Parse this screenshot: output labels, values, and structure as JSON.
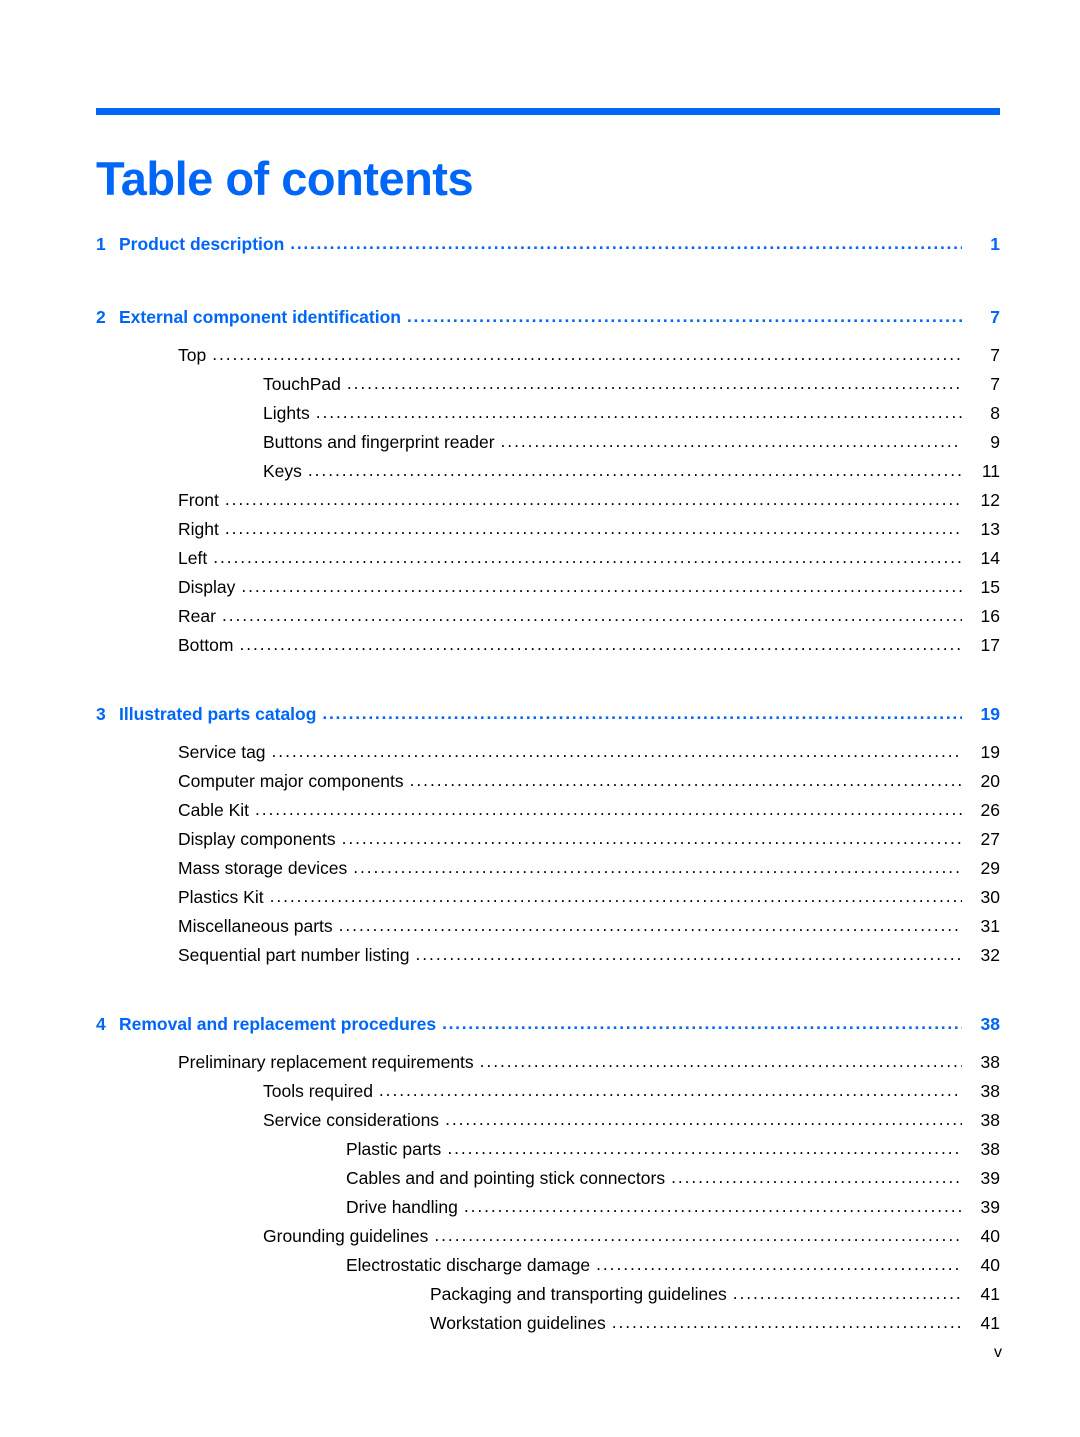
{
  "document": {
    "title": "Table of contents",
    "accent_color": "#0066f5",
    "footer_page_number": "v"
  },
  "toc": {
    "entries": [
      {
        "level": 0,
        "number": "1",
        "label": "Product description",
        "page": "1",
        "gap_before": false
      },
      {
        "level": 0,
        "number": "2",
        "label": "External component identification",
        "page": "7",
        "gap_before": true
      },
      {
        "level": 1,
        "number": "",
        "label": "Top",
        "page": "7",
        "gap_before": false
      },
      {
        "level": 2,
        "number": "",
        "label": "TouchPad",
        "page": "7",
        "gap_before": false
      },
      {
        "level": 2,
        "number": "",
        "label": "Lights",
        "page": "8",
        "gap_before": false
      },
      {
        "level": 2,
        "number": "",
        "label": "Buttons and fingerprint reader",
        "page": "9",
        "gap_before": false
      },
      {
        "level": 2,
        "number": "",
        "label": "Keys",
        "page": "11",
        "gap_before": false
      },
      {
        "level": 1,
        "number": "",
        "label": "Front",
        "page": "12",
        "gap_before": false
      },
      {
        "level": 1,
        "number": "",
        "label": "Right",
        "page": "13",
        "gap_before": false
      },
      {
        "level": 1,
        "number": "",
        "label": "Left",
        "page": "14",
        "gap_before": false
      },
      {
        "level": 1,
        "number": "",
        "label": "Display",
        "page": "15",
        "gap_before": false
      },
      {
        "level": 1,
        "number": "",
        "label": "Rear",
        "page": "16",
        "gap_before": false
      },
      {
        "level": 1,
        "number": "",
        "label": "Bottom",
        "page": "17",
        "gap_before": false
      },
      {
        "level": 0,
        "number": "3",
        "label": "Illustrated parts catalog",
        "page": "19",
        "gap_before": true
      },
      {
        "level": 1,
        "number": "",
        "label": "Service tag",
        "page": "19",
        "gap_before": false
      },
      {
        "level": 1,
        "number": "",
        "label": "Computer major components",
        "page": "20",
        "gap_before": false
      },
      {
        "level": 1,
        "number": "",
        "label": "Cable Kit",
        "page": "26",
        "gap_before": false
      },
      {
        "level": 1,
        "number": "",
        "label": "Display components",
        "page": "27",
        "gap_before": false
      },
      {
        "level": 1,
        "number": "",
        "label": "Mass storage devices",
        "page": "29",
        "gap_before": false
      },
      {
        "level": 1,
        "number": "",
        "label": "Plastics Kit",
        "page": "30",
        "gap_before": false
      },
      {
        "level": 1,
        "number": "",
        "label": "Miscellaneous parts",
        "page": "31",
        "gap_before": false
      },
      {
        "level": 1,
        "number": "",
        "label": "Sequential part number listing",
        "page": "32",
        "gap_before": false
      },
      {
        "level": 0,
        "number": "4",
        "label": "Removal and replacement procedures",
        "page": "38",
        "gap_before": true
      },
      {
        "level": 1,
        "number": "",
        "label": "Preliminary replacement requirements",
        "page": "38",
        "gap_before": false
      },
      {
        "level": 2,
        "number": "",
        "label": "Tools required",
        "page": "38",
        "gap_before": false
      },
      {
        "level": 2,
        "number": "",
        "label": "Service considerations",
        "page": "38",
        "gap_before": false
      },
      {
        "level": 3,
        "number": "",
        "label": "Plastic parts",
        "page": "38",
        "gap_before": false
      },
      {
        "level": 3,
        "number": "",
        "label": "Cables and and pointing stick connectors",
        "page": "39",
        "gap_before": false
      },
      {
        "level": 3,
        "number": "",
        "label": "Drive handling",
        "page": "39",
        "gap_before": false
      },
      {
        "level": 2,
        "number": "",
        "label": "Grounding guidelines",
        "page": "40",
        "gap_before": false
      },
      {
        "level": 3,
        "number": "",
        "label": "Electrostatic discharge damage",
        "page": "40",
        "gap_before": false
      },
      {
        "level": 4,
        "number": "",
        "label": "Packaging and transporting guidelines",
        "page": "41",
        "gap_before": false
      },
      {
        "level": 4,
        "number": "",
        "label": "Workstation guidelines",
        "page": "41",
        "gap_before": false
      }
    ]
  }
}
